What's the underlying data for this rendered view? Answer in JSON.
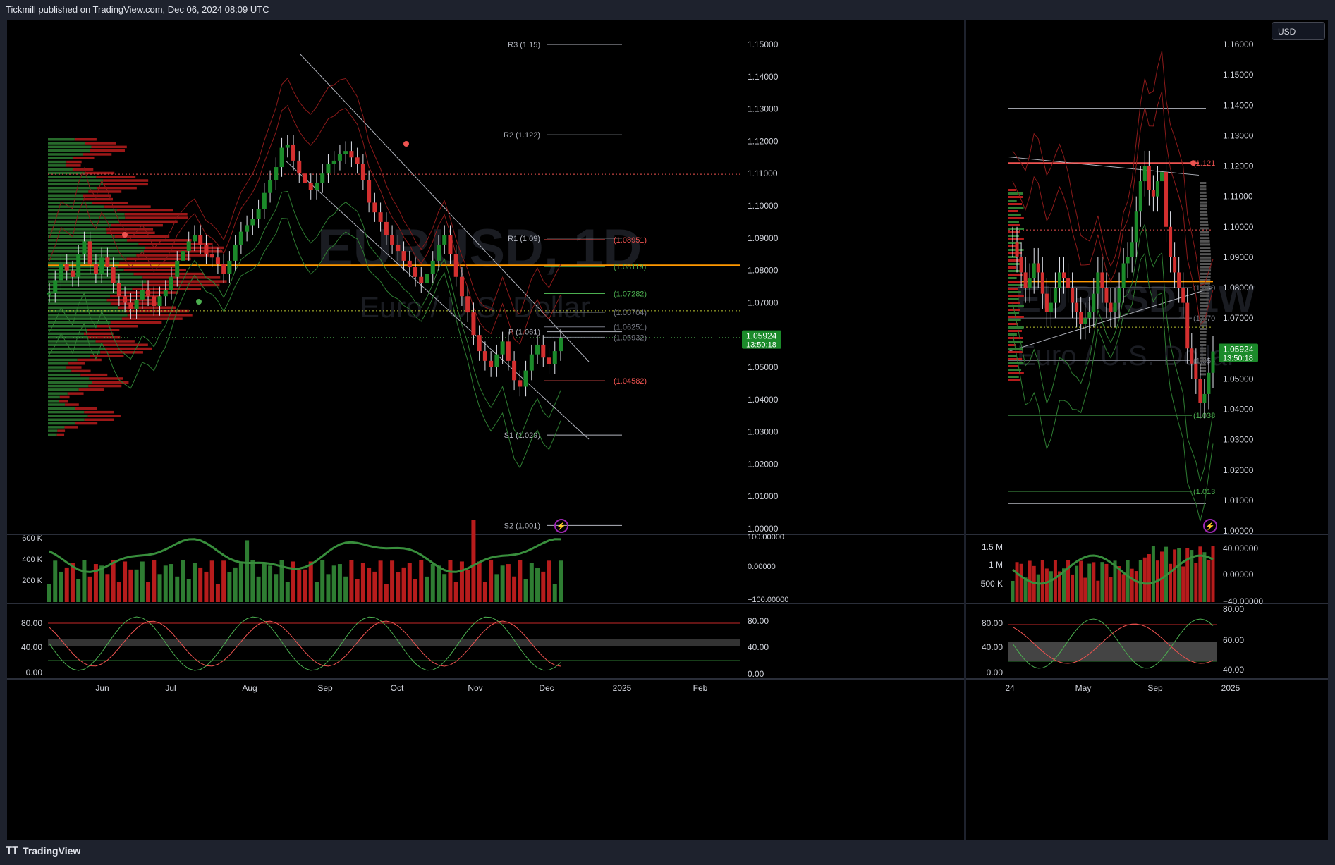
{
  "header": {
    "text": "Tickmill published on TradingView.com, Dec 06, 2024 08:09 UTC"
  },
  "footer": {
    "brand": "TradingView",
    "logo_icon": "tv-logo-icon"
  },
  "currency_button": {
    "label": "USD"
  },
  "colors": {
    "up": "#26a69a",
    "down": "#ef5350",
    "green": "#2e7d32",
    "red": "#c62828",
    "orange": "#ff9800",
    "bg": "#000000"
  },
  "left_chart": {
    "watermark_symbol": "EURUSD, 1D",
    "watermark_name": "Euro / U.S. Dollar",
    "price_axis": [
      "1.15000",
      "1.14000",
      "1.13000",
      "1.12000",
      "1.11000",
      "1.10000",
      "1.09000",
      "1.08000",
      "1.07000",
      "1.06000",
      "1.05000",
      "1.04000",
      "1.03000",
      "1.02000",
      "1.01000",
      "1.00000"
    ],
    "last_price": "1.05924",
    "countdown": "13:50:18",
    "pivots": [
      {
        "label": "R3 (1.15)",
        "value": 1.15
      },
      {
        "label": "R2 (1.122)",
        "value": 1.122
      },
      {
        "label": "R1 (1.09)",
        "value": 1.09
      },
      {
        "label": "P (1.061)",
        "value": 1.061
      },
      {
        "label": "S1 (1.029)",
        "value": 1.029
      },
      {
        "label": "S2 (1.001)",
        "value": 1.001
      }
    ],
    "level_labels": [
      {
        "label": "(1.08951)",
        "value": 1.08951,
        "color": "#ef5350"
      },
      {
        "label": "(1.08119)",
        "value": 1.08119,
        "color": "#4caf50"
      },
      {
        "label": "(1.07282)",
        "value": 1.07282,
        "color": "#4caf50"
      },
      {
        "label": "(1.06704)",
        "value": 1.06704,
        "color": "#787b86"
      },
      {
        "label": "(1.06251)",
        "value": 1.06251,
        "color": "#787b86"
      },
      {
        "label": "(1.05932)",
        "value": 1.05932,
        "color": "#787b86"
      },
      {
        "label": "(1.04582)",
        "value": 1.04582,
        "color": "#ef5350"
      }
    ],
    "time_axis": [
      "Jun",
      "Jul",
      "Aug",
      "Sep",
      "Oct",
      "Nov",
      "Dec",
      "2025",
      "Feb"
    ],
    "volume_axis": [
      "600 K",
      "400 K",
      "200 K"
    ],
    "osc1_axis": [
      "100.00000",
      "0.00000",
      "−100.00000"
    ],
    "osc2_axis_left": [
      "80.00",
      "40.00",
      "0.00"
    ],
    "osc2_axis_right": [
      "80.00",
      "40.00",
      "0.00"
    ]
  },
  "right_chart": {
    "watermark_symbol": "EURUSD, 1W",
    "watermark_name": "Euro / U.S. Dollar",
    "price_axis": [
      "1.16000",
      "1.15000",
      "1.14000",
      "1.13000",
      "1.12000",
      "1.11000",
      "1.10000",
      "1.09000",
      "1.08000",
      "1.07000",
      "1.06000",
      "1.05000",
      "1.04000",
      "1.03000",
      "1.02000",
      "1.01000",
      "1.00000"
    ],
    "last_price": "1.05924",
    "countdown": "13:50:18",
    "level_labels": [
      {
        "label": "(1.121",
        "value": 1.121,
        "color": "#ef5350"
      },
      {
        "label": "(1.080",
        "value": 1.08,
        "color": "#787b86"
      },
      {
        "label": "(1.070",
        "value": 1.07,
        "color": "#787b86"
      },
      {
        "label": "(1.056",
        "value": 1.056,
        "color": "#787b86"
      },
      {
        "label": "(1.038",
        "value": 1.038,
        "color": "#4caf50"
      },
      {
        "label": "(1.013",
        "value": 1.013,
        "color": "#4caf50"
      }
    ],
    "time_axis": [
      "24",
      "May",
      "Sep",
      "2025"
    ],
    "volume_axis": [
      "1.5 M",
      "1 M",
      "500 K"
    ],
    "osc1_axis": [
      "40.00000",
      "0.00000",
      "−40.00000"
    ],
    "osc2_axis_left": [
      "80.00",
      "40.00",
      "0.00"
    ],
    "osc2_axis_right": [
      "80.00",
      "60.00",
      "40.00"
    ]
  },
  "chart_data": [
    {
      "type": "candlestick",
      "title": "EURUSD, 1D",
      "ylim": [
        1.0,
        1.15
      ],
      "approx_closes": [
        1.073,
        1.077,
        1.082,
        1.08,
        1.078,
        1.085,
        1.089,
        1.082,
        1.079,
        1.084,
        1.081,
        1.076,
        1.072,
        1.07,
        1.068,
        1.071,
        1.074,
        1.072,
        1.069,
        1.072,
        1.074,
        1.078,
        1.083,
        1.086,
        1.089,
        1.091,
        1.088,
        1.085,
        1.084,
        1.082,
        1.079,
        1.083,
        1.088,
        1.092,
        1.094,
        1.096,
        1.099,
        1.104,
        1.108,
        1.112,
        1.118,
        1.119,
        1.114,
        1.11,
        1.107,
        1.105,
        1.107,
        1.11,
        1.113,
        1.114,
        1.116,
        1.117,
        1.115,
        1.113,
        1.108,
        1.101,
        1.098,
        1.095,
        1.091,
        1.088,
        1.086,
        1.083,
        1.081,
        1.078,
        1.076,
        1.079,
        1.083,
        1.088,
        1.091,
        1.085,
        1.078,
        1.072,
        1.067,
        1.06,
        1.055,
        1.052,
        1.05,
        1.054,
        1.058,
        1.052,
        1.046,
        1.044,
        1.049,
        1.054,
        1.057,
        1.053,
        1.051,
        1.055,
        1.059
      ]
    },
    {
      "type": "candlestick",
      "title": "EURUSD, 1W",
      "ylim": [
        1.0,
        1.16
      ],
      "approx_closes": [
        1.095,
        1.09,
        1.085,
        1.08,
        1.083,
        1.088,
        1.085,
        1.078,
        1.072,
        1.075,
        1.08,
        1.085,
        1.083,
        1.08,
        1.075,
        1.072,
        1.068,
        1.07,
        1.072,
        1.078,
        1.085,
        1.08,
        1.075,
        1.072,
        1.075,
        1.08,
        1.088,
        1.09,
        1.095,
        1.105,
        1.115,
        1.12,
        1.112,
        1.11,
        1.115,
        1.118,
        1.1,
        1.09,
        1.085,
        1.08,
        1.075,
        1.06,
        1.055,
        1.05,
        1.042,
        1.045,
        1.052,
        1.059
      ]
    }
  ]
}
